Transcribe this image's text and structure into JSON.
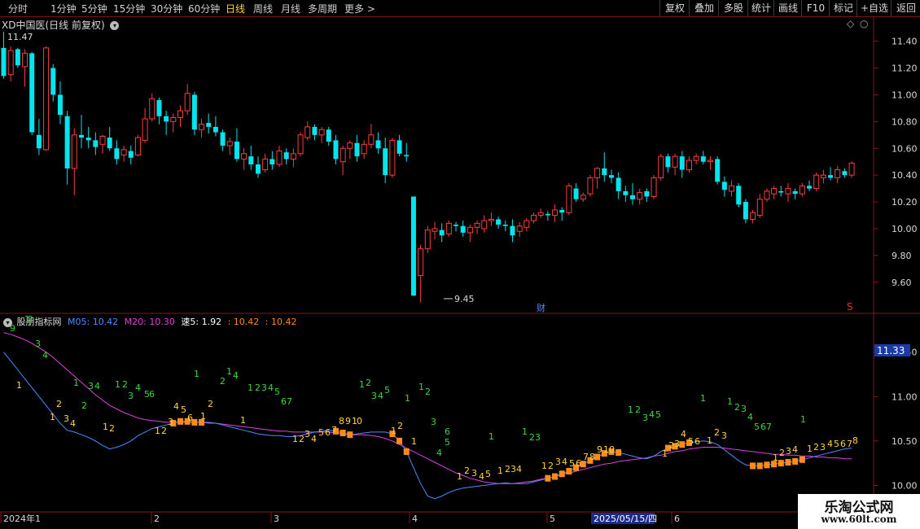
{
  "toolbar": {
    "timeframes": [
      "分时",
      "1分钟",
      "5分钟",
      "15分钟",
      "30分钟",
      "60分钟",
      "日线",
      "周线",
      "月线",
      "多周期",
      "更多 >"
    ],
    "active": "日线",
    "buttons": [
      "复权",
      "叠加",
      "多股",
      "统计",
      "画线",
      "F10",
      "标记",
      "+自选",
      "返回"
    ]
  },
  "stock_title": "XD中国医(日线 前复权)",
  "price_axis": {
    "ticks": [
      "11.40",
      "11.20",
      "11.00",
      "10.80",
      "10.60",
      "10.40",
      "10.20",
      "10.00",
      "9.80",
      "9.60"
    ],
    "high_label": "11.47",
    "low_label": "9.45",
    "marker_cai": "财",
    "marker_s": "S"
  },
  "indicator": {
    "name": "股朋指标网",
    "m05": "M05: 10.42",
    "m20": "M20: 10.30",
    "speed": "速5: 1.92",
    "v1": ": 10.42",
    "v2": ": 10.42",
    "axis_ticks": [
      "11.50",
      "11.00",
      "10.50",
      "10.00"
    ],
    "current_value": "11.33",
    "colors": {
      "m05": "#4a8cff",
      "m20": "#e040e0",
      "speed": "#ffffff",
      "v1": "#ff8c00",
      "v2": "#ff8c00"
    }
  },
  "date_axis": {
    "labels": [
      "2024年1",
      "2",
      "3",
      "4",
      "5",
      "2025/05/15/四",
      "6"
    ]
  },
  "watermark": {
    "line1": "乐淘公式网",
    "line2": "www.60lt.com"
  },
  "chart_data": {
    "type": "candlestick",
    "candles": [
      [
        11.35,
        11.47,
        11.12,
        11.14
      ],
      [
        11.15,
        11.36,
        11.1,
        11.33
      ],
      [
        11.34,
        11.35,
        11.2,
        11.22
      ],
      [
        11.21,
        11.34,
        11.06,
        11.31
      ],
      [
        11.31,
        11.32,
        10.7,
        10.72
      ],
      [
        10.7,
        10.82,
        10.55,
        10.6
      ],
      [
        10.59,
        11.36,
        10.58,
        11.35
      ],
      [
        11.2,
        11.23,
        10.95,
        11.0
      ],
      [
        11.0,
        11.1,
        10.78,
        10.85
      ],
      [
        10.84,
        10.88,
        10.33,
        10.45
      ],
      [
        10.45,
        10.75,
        10.25,
        10.7
      ],
      [
        10.7,
        10.85,
        10.6,
        10.68
      ],
      [
        10.68,
        10.76,
        10.6,
        10.66
      ],
      [
        10.66,
        10.72,
        10.55,
        10.61
      ],
      [
        10.63,
        10.7,
        10.56,
        10.69
      ],
      [
        10.68,
        10.76,
        10.58,
        10.6
      ],
      [
        10.6,
        10.66,
        10.48,
        10.52
      ],
      [
        10.55,
        10.62,
        10.5,
        10.59
      ],
      [
        10.58,
        10.62,
        10.48,
        10.53
      ],
      [
        10.55,
        10.7,
        10.54,
        10.68
      ],
      [
        10.66,
        10.9,
        10.64,
        10.82
      ],
      [
        10.82,
        11.01,
        10.8,
        10.97
      ],
      [
        10.96,
        10.98,
        10.78,
        10.84
      ],
      [
        10.84,
        10.88,
        10.7,
        10.8
      ],
      [
        10.8,
        10.86,
        10.72,
        10.83
      ],
      [
        10.83,
        10.92,
        10.76,
        10.88
      ],
      [
        10.88,
        11.08,
        10.85,
        11.01
      ],
      [
        11.0,
        11.02,
        10.7,
        10.74
      ],
      [
        10.74,
        10.82,
        10.68,
        10.78
      ],
      [
        10.79,
        10.86,
        10.71,
        10.76
      ],
      [
        10.76,
        10.84,
        10.69,
        10.72
      ],
      [
        10.72,
        10.74,
        10.58,
        10.62
      ],
      [
        10.62,
        10.68,
        10.55,
        10.65
      ],
      [
        10.65,
        10.75,
        10.5,
        10.52
      ],
      [
        10.52,
        10.6,
        10.44,
        10.56
      ],
      [
        10.54,
        10.62,
        10.44,
        10.48
      ],
      [
        10.48,
        10.54,
        10.38,
        10.41
      ],
      [
        10.44,
        10.56,
        10.42,
        10.52
      ],
      [
        10.52,
        10.58,
        10.44,
        10.48
      ],
      [
        10.48,
        10.62,
        10.46,
        10.58
      ],
      [
        10.57,
        10.6,
        10.48,
        10.52
      ],
      [
        10.52,
        10.6,
        10.46,
        10.56
      ],
      [
        10.56,
        10.72,
        10.54,
        10.7
      ],
      [
        10.68,
        10.8,
        10.66,
        10.76
      ],
      [
        10.76,
        10.78,
        10.66,
        10.7
      ],
      [
        10.7,
        10.76,
        10.64,
        10.74
      ],
      [
        10.74,
        10.76,
        10.62,
        10.65
      ],
      [
        10.66,
        10.7,
        10.48,
        10.52
      ],
      [
        10.5,
        10.62,
        10.4,
        10.6
      ],
      [
        10.6,
        10.66,
        10.52,
        10.64
      ],
      [
        10.64,
        10.7,
        10.5,
        10.54
      ],
      [
        10.56,
        10.66,
        10.52,
        10.63
      ],
      [
        10.63,
        10.78,
        10.6,
        10.7
      ],
      [
        10.66,
        10.72,
        10.56,
        10.6
      ],
      [
        10.6,
        10.68,
        10.34,
        10.4
      ],
      [
        10.4,
        10.68,
        10.38,
        10.66
      ],
      [
        10.66,
        10.7,
        10.54,
        10.56
      ],
      [
        10.55,
        10.64,
        10.5,
        10.54
      ],
      [
        10.24,
        10.24,
        9.5,
        9.5
      ],
      [
        9.65,
        9.88,
        9.45,
        9.85
      ],
      [
        9.85,
        10.02,
        9.82,
        9.99
      ],
      [
        9.98,
        10.05,
        9.92,
        10.0
      ],
      [
        9.99,
        10.04,
        9.9,
        9.95
      ],
      [
        9.96,
        10.06,
        9.94,
        10.04
      ],
      [
        10.03,
        10.05,
        9.98,
        10.02
      ],
      [
        10.02,
        10.06,
        9.94,
        9.97
      ],
      [
        9.97,
        10.03,
        9.9,
        10.01
      ],
      [
        10.01,
        10.06,
        9.96,
        10.04
      ],
      [
        10.0,
        10.1,
        9.97,
        10.06
      ],
      [
        10.06,
        10.12,
        10.02,
        10.07
      ],
      [
        10.07,
        10.09,
        10.0,
        10.03
      ],
      [
        10.03,
        10.06,
        9.98,
        10.02
      ],
      [
        10.02,
        10.07,
        9.9,
        9.95
      ],
      [
        9.98,
        10.05,
        9.94,
        10.02
      ],
      [
        10.01,
        10.08,
        9.98,
        10.06
      ],
      [
        10.06,
        10.12,
        10.04,
        10.1
      ],
      [
        10.1,
        10.15,
        10.08,
        10.12
      ],
      [
        10.11,
        10.13,
        10.06,
        10.1
      ],
      [
        10.1,
        10.18,
        10.05,
        10.14
      ],
      [
        10.14,
        10.16,
        10.06,
        10.12
      ],
      [
        10.12,
        10.34,
        10.1,
        10.32
      ],
      [
        10.3,
        10.34,
        10.2,
        10.22
      ],
      [
        10.22,
        10.27,
        10.2,
        10.25
      ],
      [
        10.26,
        10.4,
        10.24,
        10.38
      ],
      [
        10.38,
        10.46,
        10.3,
        10.45
      ],
      [
        10.45,
        10.57,
        10.35,
        10.4
      ],
      [
        10.4,
        10.44,
        10.34,
        10.38
      ],
      [
        10.38,
        10.42,
        10.22,
        10.28
      ],
      [
        10.28,
        10.32,
        10.2,
        10.25
      ],
      [
        10.25,
        10.34,
        10.18,
        10.22
      ],
      [
        10.22,
        10.3,
        10.18,
        10.27
      ],
      [
        10.28,
        10.3,
        10.2,
        10.24
      ],
      [
        10.24,
        10.4,
        10.22,
        10.38
      ],
      [
        10.38,
        10.56,
        10.36,
        10.54
      ],
      [
        10.54,
        10.56,
        10.42,
        10.46
      ],
      [
        10.46,
        10.56,
        10.4,
        10.54
      ],
      [
        10.54,
        10.58,
        10.38,
        10.44
      ],
      [
        10.44,
        10.54,
        10.42,
        10.51
      ],
      [
        10.51,
        10.56,
        10.48,
        10.54
      ],
      [
        10.54,
        10.58,
        10.48,
        10.5
      ],
      [
        10.5,
        10.54,
        10.44,
        10.51
      ],
      [
        10.52,
        10.54,
        10.33,
        10.35
      ],
      [
        10.35,
        10.39,
        10.24,
        10.29
      ],
      [
        10.28,
        10.36,
        10.24,
        10.32
      ],
      [
        10.32,
        10.34,
        10.16,
        10.18
      ],
      [
        10.2,
        10.22,
        10.04,
        10.07
      ],
      [
        10.07,
        10.14,
        10.04,
        10.12
      ],
      [
        10.1,
        10.26,
        10.08,
        10.22
      ],
      [
        10.22,
        10.3,
        10.2,
        10.28
      ],
      [
        10.26,
        10.32,
        10.22,
        10.3
      ],
      [
        10.28,
        10.32,
        10.24,
        10.27
      ],
      [
        10.26,
        10.34,
        10.2,
        10.3
      ],
      [
        10.28,
        10.3,
        10.22,
        10.26
      ],
      [
        10.26,
        10.34,
        10.24,
        10.32
      ],
      [
        10.32,
        10.36,
        10.28,
        10.3
      ],
      [
        10.3,
        10.42,
        10.28,
        10.4
      ],
      [
        10.38,
        10.44,
        10.34,
        10.4
      ],
      [
        10.4,
        10.46,
        10.36,
        10.38
      ],
      [
        10.38,
        10.47,
        10.34,
        10.44
      ],
      [
        10.43,
        10.45,
        10.38,
        10.4
      ],
      [
        10.4,
        10.5,
        10.38,
        10.49
      ]
    ],
    "ylim": [
      9.38,
      11.58
    ],
    "indicator": {
      "ylim": [
        9.72,
        11.9
      ],
      "m05_blue": [
        11.5,
        11.4,
        11.3,
        11.2,
        11.1,
        11.0,
        10.9,
        10.8,
        10.7,
        10.62,
        10.6,
        10.57,
        10.54,
        10.5,
        10.45,
        10.41,
        10.43,
        10.46,
        10.5,
        10.56,
        10.6,
        10.64,
        10.66,
        10.68,
        10.7,
        10.72,
        10.72,
        10.71,
        10.71,
        10.71,
        10.7,
        10.68,
        10.66,
        10.64,
        10.62,
        10.6,
        10.58,
        10.57,
        10.56,
        10.56,
        10.55,
        10.55,
        10.56,
        10.58,
        10.6,
        10.61,
        10.62,
        10.61,
        10.59,
        10.57,
        10.58,
        10.59,
        10.6,
        10.6,
        10.6,
        10.58,
        10.5,
        10.38,
        10.2,
        10.02,
        9.88,
        9.85,
        9.88,
        9.92,
        9.95,
        9.97,
        9.98,
        9.99,
        10.0,
        10.01,
        10.02,
        10.03,
        10.02,
        10.02,
        10.02,
        10.04,
        10.06,
        10.08,
        10.1,
        10.13,
        10.16,
        10.2,
        10.24,
        10.28,
        10.32,
        10.36,
        10.38,
        10.37,
        10.35,
        10.33,
        10.31,
        10.3,
        10.33,
        10.38,
        10.42,
        10.44,
        10.46,
        10.48,
        10.49,
        10.5,
        10.49,
        10.46,
        10.4,
        10.34,
        10.28,
        10.23,
        10.22,
        10.22,
        10.23,
        10.24,
        10.25,
        10.26,
        10.27,
        10.29,
        10.31,
        10.33,
        10.35,
        10.37,
        10.39,
        10.41,
        10.42
      ],
      "m20_purple": [
        11.72,
        11.7,
        11.67,
        11.64,
        11.6,
        11.55,
        11.5,
        11.44,
        11.37,
        11.3,
        11.23,
        11.16,
        11.09,
        11.02,
        10.96,
        10.9,
        10.86,
        10.82,
        10.79,
        10.76,
        10.74,
        10.73,
        10.72,
        10.71,
        10.71,
        10.71,
        10.71,
        10.71,
        10.71,
        10.7,
        10.7,
        10.69,
        10.68,
        10.67,
        10.66,
        10.65,
        10.64,
        10.63,
        10.62,
        10.61,
        10.61,
        10.6,
        10.6,
        10.6,
        10.6,
        10.6,
        10.6,
        10.59,
        10.58,
        10.57,
        10.57,
        10.57,
        10.56,
        10.55,
        10.53,
        10.5,
        10.46,
        10.42,
        10.38,
        10.34,
        10.3,
        10.26,
        10.22,
        10.18,
        10.14,
        10.11,
        10.08,
        10.06,
        10.04,
        10.03,
        10.02,
        10.02,
        10.02,
        10.03,
        10.04,
        10.05,
        10.07,
        10.08,
        10.1,
        10.12,
        10.14,
        10.16,
        10.18,
        10.2,
        10.22,
        10.24,
        10.25,
        10.27,
        10.28,
        10.29,
        10.3,
        10.31,
        10.33,
        10.34,
        10.36,
        10.38,
        10.39,
        10.41,
        10.42,
        10.43,
        10.43,
        10.43,
        10.42,
        10.41,
        10.4,
        10.39,
        10.38,
        10.37,
        10.36,
        10.35,
        10.35,
        10.34,
        10.34,
        10.33,
        10.33,
        10.32,
        10.32,
        10.31,
        10.31,
        10.3,
        10.3
      ]
    }
  }
}
